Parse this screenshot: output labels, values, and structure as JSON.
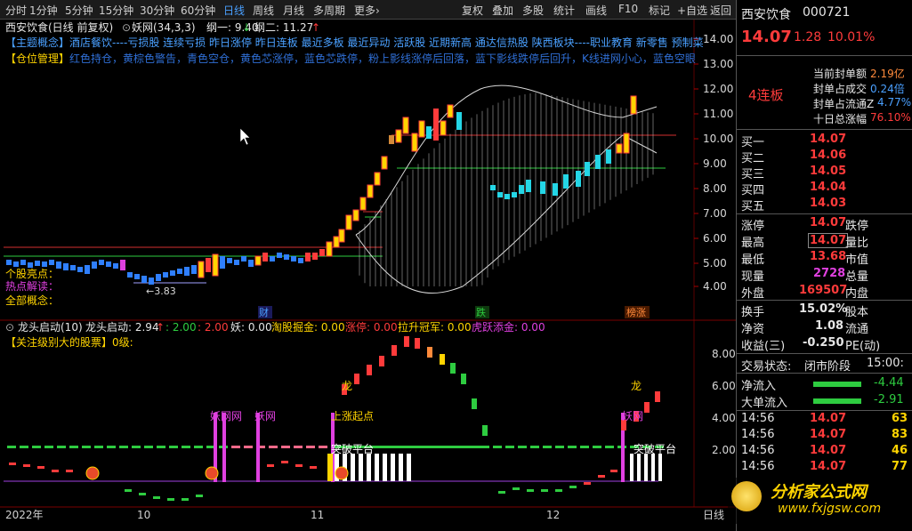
{
  "toolbar": {
    "periods": [
      "分时",
      "1分钟",
      "5分钟",
      "15分钟",
      "30分钟",
      "60分钟",
      "日线",
      "周线",
      "月线",
      "多周期",
      "更多"
    ],
    "active_period": "日线",
    "more_arrow": "›",
    "right_buttons": [
      "复权",
      "叠加",
      "多股",
      "统计",
      "画线",
      "F10",
      "标记",
      "+自选",
      "返回"
    ]
  },
  "chart_header": {
    "title": "西安饮食(日线 前复权)",
    "indicator": "妖网(34,3,3)",
    "line1_label": "纲一: 9.40",
    "line1_arrow": "↓",
    "line2_label": "纲二: 11.27",
    "line2_arrow": "↑"
  },
  "concept_line": "【主题概念】酒店餐饮----亏损股 连续亏损 昨日涨停 昨日连板 最近多板 最近异动 活跃股 近期新高 通达信热股 陕西板块----职业教育 新零售 预制菜",
  "position_line_label": "【仓位管理】",
  "position_line_text": "红色持仓，黄棕色警告，青色空仓，黄色芯涨停，蓝色芯跌停，粉上影线涨停后回落，蓝下影线跌停后回升，K线进网小心，蓝色空眼",
  "side_labels": {
    "bright": "个股亮点：",
    "hot": "热点解读：",
    "all": "全部概念："
  },
  "low_marker": "←3.83",
  "main_y_ticks": [
    "14.00",
    "13.00",
    "12.00",
    "11.00",
    "10.00",
    "9.00",
    "8.00",
    "7.00",
    "6.00",
    "5.00",
    "4.00"
  ],
  "bottom_tags": {
    "cai": "财",
    "die": "跌",
    "bang": "榜涨"
  },
  "sub_header": {
    "icon": "⊙",
    "name": "龙头启动(10)",
    "v1": "龙头启动: 2.94",
    "v1_arrow": "↑",
    "v2": ": 2.00",
    "v3": ": 2.00",
    "v4": "妖: 0.00",
    "v5": "淘股掘金: 0.00",
    "v6": "涨停: 0.00",
    "v7": "拉升冠军: 0.00",
    "v8": "虎跃添金: 0.00"
  },
  "sub_line2": "【关注级别大的股票】0级:",
  "sub_labels": {
    "long1": "龙",
    "long2": "龙",
    "yao1": "妖网网",
    "yao2": "妖网",
    "start": "上涨起点",
    "yao3": "妖网",
    "breakout1": "突破平台",
    "breakout2": "突破平台"
  },
  "sub_y_ticks": [
    "8.00",
    "6.00",
    "4.00",
    "2.00"
  ],
  "date_axis": {
    "year": "2022年",
    "m10": "10",
    "m11": "11",
    "m12": "12",
    "unit": "日线"
  },
  "stock": {
    "name": "西安饮食",
    "code": "000721",
    "price": "14.07",
    "change": "1.28",
    "pct": "10.01%"
  },
  "board": {
    "tag": "4连板",
    "items": [
      {
        "label": "当前封单额",
        "value": "2.19亿"
      },
      {
        "label": "封单占成交",
        "value": "0.24倍"
      },
      {
        "label": "封单占流通Z",
        "value": "4.77%"
      },
      {
        "label": "十日总涨幅",
        "value": "76.10%"
      }
    ]
  },
  "bids": [
    {
      "label": "买一",
      "price": "14.07",
      "vol": ""
    },
    {
      "label": "买二",
      "price": "14.06",
      "vol": ""
    },
    {
      "label": "买三",
      "price": "14.05",
      "vol": ""
    },
    {
      "label": "买四",
      "price": "14.04",
      "vol": ""
    },
    {
      "label": "买五",
      "price": "14.03",
      "vol": ""
    }
  ],
  "quote": [
    {
      "l": "涨停",
      "v": "14.07",
      "l2": "跌停",
      "v2": ""
    },
    {
      "l": "最高",
      "v": "14.07",
      "l2": "量比",
      "v2": ""
    },
    {
      "l": "最低",
      "v": "13.68",
      "l2": "市值",
      "v2": ""
    },
    {
      "l": "现量",
      "v": "2728",
      "l2": "总量",
      "v2": ""
    },
    {
      "l": "外盘",
      "v": "169507",
      "l2": "内盘",
      "v2": ""
    }
  ],
  "fund": [
    {
      "l": "换手",
      "v": "15.02%",
      "l2": "股本"
    },
    {
      "l": "净资",
      "v": "1.08",
      "l2": "流通"
    },
    {
      "l": "收益(三)",
      "v": "-0.250",
      "l2": "PE(动)"
    }
  ],
  "status": {
    "label": "交易状态:",
    "value": "闭市阶段",
    "time": "15:00:"
  },
  "flows": [
    {
      "label": "净流入",
      "value": "-4.44"
    },
    {
      "label": "大单流入",
      "value": "-2.91"
    }
  ],
  "ticks": [
    {
      "time": "14:56",
      "price": "14.07",
      "vol": "63"
    },
    {
      "time": "14:56",
      "price": "14.07",
      "vol": "83"
    },
    {
      "time": "14:56",
      "price": "14.07",
      "vol": "46"
    },
    {
      "time": "14:56",
      "price": "14.07",
      "vol": "77"
    }
  ],
  "watermark": {
    "main": "分析家公式网",
    "sub": "www.fxjgsw.com"
  },
  "colors": {
    "up": "#ff3b3b",
    "down": "#24d6e6",
    "yellow": "#ffd400",
    "magenta": "#e040e0",
    "green": "#2ecc40"
  }
}
